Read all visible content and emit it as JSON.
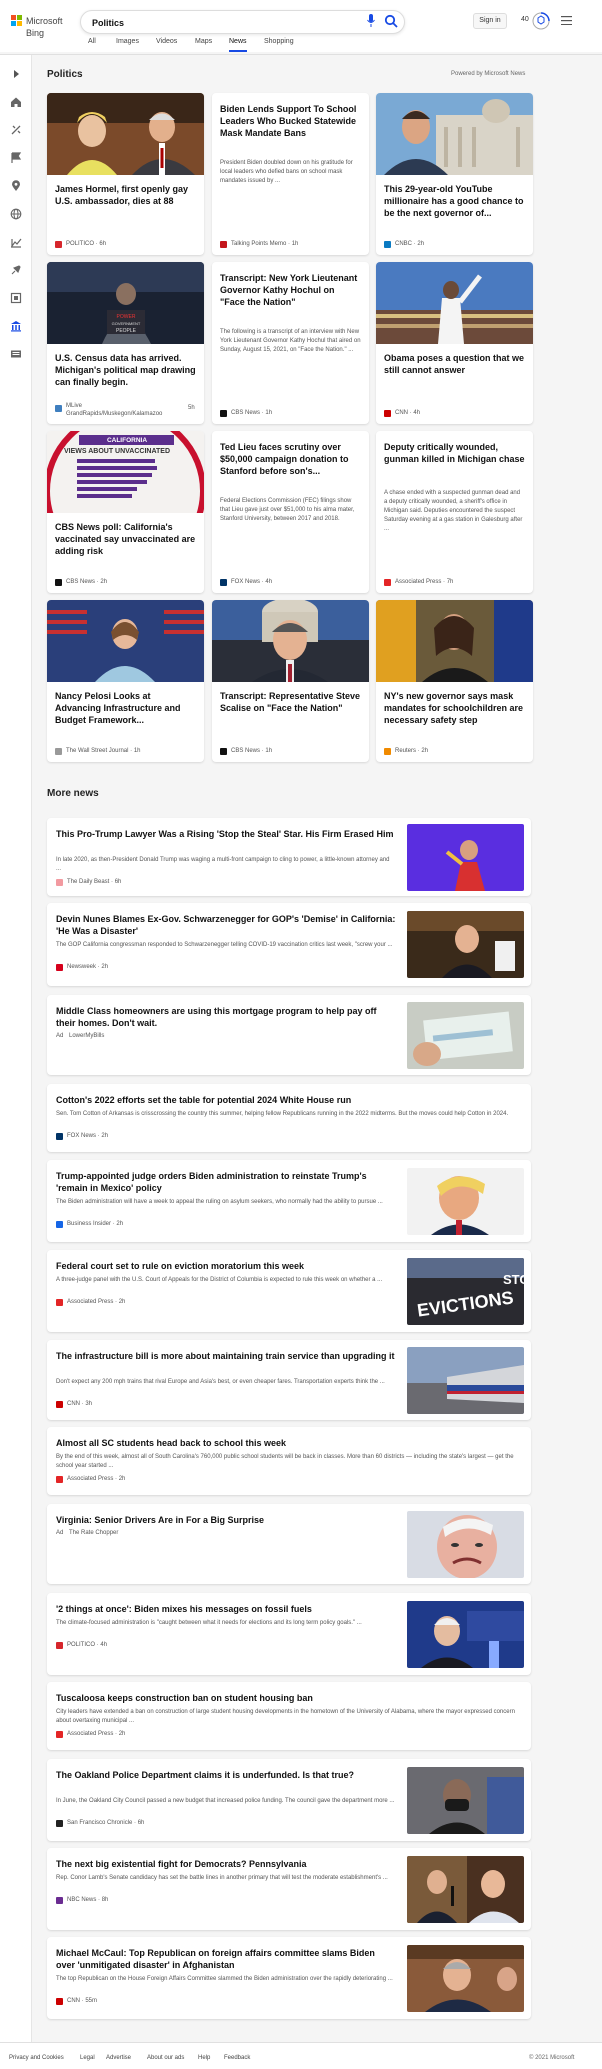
{
  "header": {
    "logo_text": "Microsoft Bing",
    "search_value": "Politics",
    "signin_label": "Sign in",
    "points": "40",
    "tabs": [
      "All",
      "Images",
      "Videos",
      "Maps",
      "News",
      "Shopping"
    ],
    "active_tab": "News"
  },
  "section": {
    "title": "Politics",
    "powered_by": "Powered by Microsoft News"
  },
  "cards": [
    {
      "title": "James Hormel, first openly gay U.S. ambassador, dies at 88",
      "snippet": "",
      "source": "POLITICO",
      "time": "6h",
      "logo_color": "#d6262c"
    },
    {
      "title": "Biden Lends Support To School Leaders Who Bucked Statewide Mask Mandate Bans",
      "snippet": "President Biden doubled down on his gratitude for local leaders who defied bans on school mask mandates issued by ...",
      "source": "Talking Points Memo",
      "time": "1h",
      "logo_color": "#c4161c"
    },
    {
      "title": "This 29-year-old YouTube millionaire has a good chance to be the next governor of...",
      "snippet": "",
      "source": "CNBC",
      "time": "2h",
      "logo_color": "#0a7ac2"
    },
    {
      "title": "U.S. Census data has arrived. Michigan's political map drawing can finally begin.",
      "snippet": "",
      "source": "MLive GrandRapids/Muskegon/Kalamazoo",
      "time": "5h",
      "logo_color": "#3f7fbf"
    },
    {
      "title": "Transcript: New York Lieutenant Governor Kathy Hochul on \"Face the Nation\"",
      "snippet": "The following is a transcript of an interview with New York Lieutenant Governor Kathy Hochul that aired on Sunday, August 15, 2021, on \"Face the Nation.\" ...",
      "source": "CBS News",
      "time": "1h",
      "logo_color": "#111111"
    },
    {
      "title": "Obama poses a question that we still cannot answer",
      "snippet": "",
      "source": "CNN",
      "time": "4h",
      "logo_color": "#cc0000"
    },
    {
      "title": "CBS News poll: California's vaccinated say unvaccinated are adding risk",
      "snippet": "",
      "source": "CBS News",
      "time": "2h",
      "logo_color": "#111111"
    },
    {
      "title": "Ted Lieu faces scrutiny over $50,000 campaign donation to Stanford before son's...",
      "snippet": "Federal Elections Commission (FEC) filings show that Lieu gave just over $51,000 to his alma mater, Stanford University, between 2017 and 2018.",
      "source": "FOX News",
      "time": "4h",
      "logo_color": "#003366"
    },
    {
      "title": "Deputy critically wounded, gunman killed in Michigan chase",
      "snippet": "A chase ended with a suspected gunman dead and a deputy critically wounded, a sheriff's office in Michigan said. Deputies encountered the suspect Saturday evening at a gas station in Galesburg after ...",
      "source": "Associated Press",
      "time": "7h",
      "logo_color": "#e32526"
    },
    {
      "title": "Nancy Pelosi Looks at Advancing Infrastructure and Budget Framework...",
      "snippet": "",
      "source": "The Wall Street Journal",
      "time": "1h",
      "logo_color": "#999999"
    },
    {
      "title": "Transcript: Representative Steve Scalise on \"Face the Nation\"",
      "snippet": "",
      "source": "CBS News",
      "time": "1h",
      "logo_color": "#111111"
    },
    {
      "title": "NY's new governor says mask mandates for schoolchildren are necessary safety step",
      "snippet": "",
      "source": "Reuters",
      "time": "2h",
      "logo_color": "#f08a00"
    }
  ],
  "more_news": {
    "title": "More news",
    "items": [
      {
        "title": "This Pro-Trump Lawyer Was a Rising 'Stop the Steal' Star. His Firm Erased Him",
        "snippet": "In late 2020, as then-President Donald Trump was waging a multi-front campaign to cling to power, a little-known attorney and ...",
        "source": "The Daily Beast",
        "time": "6h",
        "logo_color": "#f29aa0",
        "has_image": true
      },
      {
        "title": "Devin Nunes Blames Ex-Gov. Schwarzenegger for GOP's 'Demise' in California: 'He Was a Disaster'",
        "snippet": "The GOP California congressman responded to Schwarzenegger telling COVID-19 vaccination critics last week, \"screw your ...",
        "source": "Newsweek",
        "time": "2h",
        "logo_color": "#d6001c",
        "has_image": true
      },
      {
        "title": "Middle Class homeowners are using this mortgage program to help pay off their homes. Don't wait.",
        "snippet": "",
        "source": "LowerMyBills",
        "time": "",
        "ad": "Ad",
        "logo_color": "",
        "has_image": true
      },
      {
        "title": "Cotton's 2022 efforts set the table for potential 2024 White House run",
        "snippet": "Sen. Tom Cotton of Arkansas is crisscrossing the country this summer, helping fellow Republicans running in the 2022 midterms. But the moves could help Cotton in 2024.",
        "source": "FOX News",
        "time": "2h",
        "logo_color": "#003366",
        "has_image": false
      },
      {
        "title": "Trump-appointed judge orders Biden administration to reinstate Trump's 'remain in Mexico' policy",
        "snippet": "The Biden administration will have a week to appeal the ruling on asylum seekers, who normally had the ability to pursue ...",
        "source": "Business Insider",
        "time": "2h",
        "logo_color": "#1565e6",
        "has_image": true
      },
      {
        "title": "Federal court set to rule on eviction moratorium this week",
        "snippet": "A three-judge panel with the U.S. Court of Appeals for the District of Columbia is expected to rule this week on whether a ...",
        "source": "Associated Press",
        "time": "2h",
        "logo_color": "#e32526",
        "has_image": true
      },
      {
        "title": "The infrastructure bill is more about maintaining train service than upgrading it",
        "snippet": "Don't expect any 200 mph trains that rival Europe and Asia's best, or even cheaper fares. Transportation experts think the ...",
        "source": "CNN",
        "time": "3h",
        "logo_color": "#cc0000",
        "has_image": true
      },
      {
        "title": "Almost all SC students head back to school this week",
        "snippet": "By the end of this week, almost all of South Carolina's 760,000 public school students will be back in classes. More than 60 districts — including the state's largest — get the school year started ...",
        "source": "Associated Press",
        "time": "2h",
        "logo_color": "#e32526",
        "has_image": false
      },
      {
        "title": "Virginia: Senior Drivers Are in For a Big Surprise",
        "snippet": "",
        "source": "The Rate Chopper",
        "time": "",
        "ad": "Ad",
        "logo_color": "",
        "has_image": true
      },
      {
        "title": "'2 things at once': Biden mixes his messages on fossil fuels",
        "snippet": "The climate-focused administration is \"caught between what it needs for elections and its long term policy goals.\" ...",
        "source": "POLITICO",
        "time": "4h",
        "logo_color": "#d6262c",
        "has_image": true
      },
      {
        "title": "Tuscaloosa keeps construction ban on student housing ban",
        "snippet": "City leaders have extended a ban on construction of large student housing developments in the hometown of the University of Alabama, where the mayor expressed concern about overtaxing municipal ...",
        "source": "Associated Press",
        "time": "2h",
        "logo_color": "#e32526",
        "has_image": false
      },
      {
        "title": "The Oakland Police Department claims it is underfunded. Is that true?",
        "snippet": "In June, the Oakland City Council passed a new budget that increased police funding. The council gave the department more ...",
        "source": "San Francisco Chronicle",
        "time": "6h",
        "logo_color": "#222222",
        "has_image": true
      },
      {
        "title": "The next big existential fight for Democrats? Pennsylvania",
        "snippet": "Rep. Conor Lamb's Senate candidacy has set the battle lines in another primary that will test the moderate establishment's ...",
        "source": "NBC News",
        "time": "8h",
        "logo_color": "#6a2c91",
        "has_image": true
      },
      {
        "title": "Michael McCaul: Top Republican on foreign affairs committee slams Biden over 'unmitigated disaster' in Afghanistan",
        "snippet": "The top Republican on the House Foreign Affairs Committee slammed the Biden administration over the rapidly deteriorating ...",
        "source": "CNN",
        "time": "55m",
        "logo_color": "#cc0000",
        "has_image": true
      }
    ]
  },
  "footer": {
    "links": [
      "Privacy and Cookies",
      "Legal",
      "Advertise",
      "About our ads",
      "Help",
      "Feedback"
    ],
    "copyright": "© 2021 Microsoft"
  },
  "colors": {
    "accent": "#174ae4",
    "background": "#f5f5f5"
  },
  "icons": [
    "search-icon",
    "microphone-icon",
    "rewards-icon",
    "menu-icon",
    "expand-icon",
    "home-icon",
    "discover-icon",
    "following-icon",
    "local-icon",
    "world-icon",
    "business-icon",
    "technology-icon",
    "entertainment-icon",
    "politics-icon",
    "news-icon"
  ]
}
